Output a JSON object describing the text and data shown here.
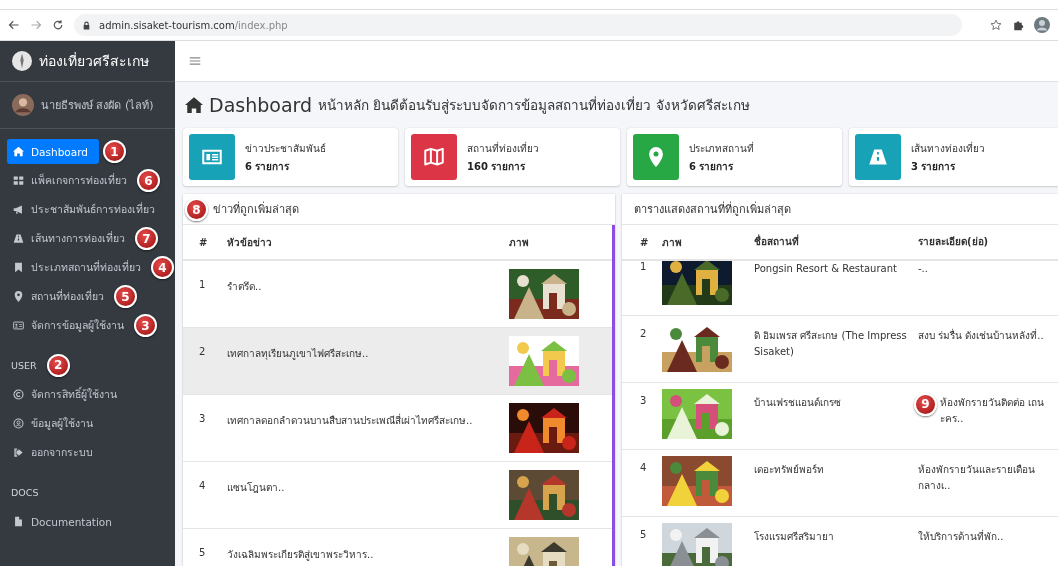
{
  "browser": {
    "url_host": "admin.sisaket-tourism.com",
    "url_path": "/index.php"
  },
  "sidebar": {
    "brand": "ท่องเที่ยวศรีสะเกษ",
    "user": "นายธีรพงษ์ สงผัด (ไลท์)",
    "items": [
      {
        "label": "Dashboard",
        "selected": true,
        "marker": "1"
      },
      {
        "label": "แพ็คเกจการท่องเที่ยว",
        "selected": false,
        "marker": "6"
      },
      {
        "label": "ประชาสัมพันธ์การท่องเที่ยว",
        "selected": false
      },
      {
        "label": "เส้นทางการท่องเที่ยว",
        "selected": false,
        "marker": "7"
      },
      {
        "label": "ประเภทสถานที่ท่องเที่ยว",
        "selected": false,
        "marker": "4"
      },
      {
        "label": "สถานที่ท่องเที่ยว",
        "selected": false,
        "marker": "5"
      },
      {
        "label": "จัดการข้อมูลผู้ใช้งาน",
        "selected": false,
        "marker": "3"
      }
    ],
    "sections": [
      {
        "header": "USER",
        "marker": "2",
        "items": [
          {
            "label": "จัดการสิทธิ์ผู้ใช้งาน",
            "selected": false
          },
          {
            "label": "ข้อมูลผู้ใช้งาน",
            "selected": false
          },
          {
            "label": "ออกจากระบบ",
            "selected": false
          }
        ]
      },
      {
        "header": "DOCS",
        "items": [
          {
            "label": "Documentation",
            "selected": false
          }
        ]
      }
    ]
  },
  "page": {
    "title": "Dashboard",
    "subtitle": "หน้าหลัก ยินดีต้อนรับสู่ระบบจัดการข้อมูลสถานที่ท่องเที่ยว จังหวัดศรีสะเกษ"
  },
  "stats": [
    {
      "label": "ข่าวประชาสัมพันธ์",
      "count": "6 รายการ",
      "color": "#17a2b8"
    },
    {
      "label": "สถานที่ท่องเที่ยว",
      "count": "160 รายการ",
      "color": "#dc3545"
    },
    {
      "label": "ประเภทสถานที่",
      "count": "6 รายการ",
      "color": "#28a745"
    },
    {
      "label": "เส้นทางท่องเที่ยว",
      "count": "3 รายการ",
      "color": "#17a2b8"
    }
  ],
  "news": {
    "title": "ข่าวที่ถูกเพิ่มล่าสุด",
    "marker": "8",
    "columns": [
      "#",
      "หัวข้อข่าว",
      "ภาพ"
    ],
    "rows": [
      {
        "number": "1",
        "title": "รำตรึด..",
        "selected": false
      },
      {
        "number": "2",
        "title": "เทศกาลทุเรียนภูเขาไฟศรีสะเกษ..",
        "selected": true
      },
      {
        "number": "3",
        "title": "เทศกาลดอกลำดวนบานสืบสานประเพณีสี่เผ่าไทศรีสะเกษ..",
        "selected": false
      },
      {
        "number": "4",
        "title": "แซนโฎนตา..",
        "selected": false
      },
      {
        "number": "5",
        "title": "วังเฉลิมพระเกียรติสู่เขาพระวิหาร..",
        "selected": false
      }
    ]
  },
  "places": {
    "title": "ตารางแสดงสถานที่ที่ถูกเพิ่มล่าสุด",
    "columns": [
      "#",
      "ภาพ",
      "ชื่อสถานที่",
      "รายละเอียด(ย่อ)"
    ],
    "rows": [
      {
        "number": "1",
        "name": "Pongsin Resort & Restaurant",
        "detail": "-.."
      },
      {
        "number": "2",
        "name": "ดิ อิมเพรส ศรีสะเกษ (The Impress Sisaket)",
        "detail": "สงบ ร่มรื่น ดังเช่นบ้านหลังที่.."
      },
      {
        "number": "3",
        "name": "บ้านเฟรชแอนด์เกรซ",
        "detail": "ห้องพักรายวันติดต่อ เถนะคร..",
        "marker": "9"
      },
      {
        "number": "4",
        "name": "เดอะทรัพย์พอร์ท",
        "detail": "ห้องพักรายวันและรายเดือน กลางเ.."
      },
      {
        "number": "5",
        "name": "โรงแรมศรีสริมายา",
        "detail": "ให้บริการด้านที่พัก.."
      }
    ]
  }
}
